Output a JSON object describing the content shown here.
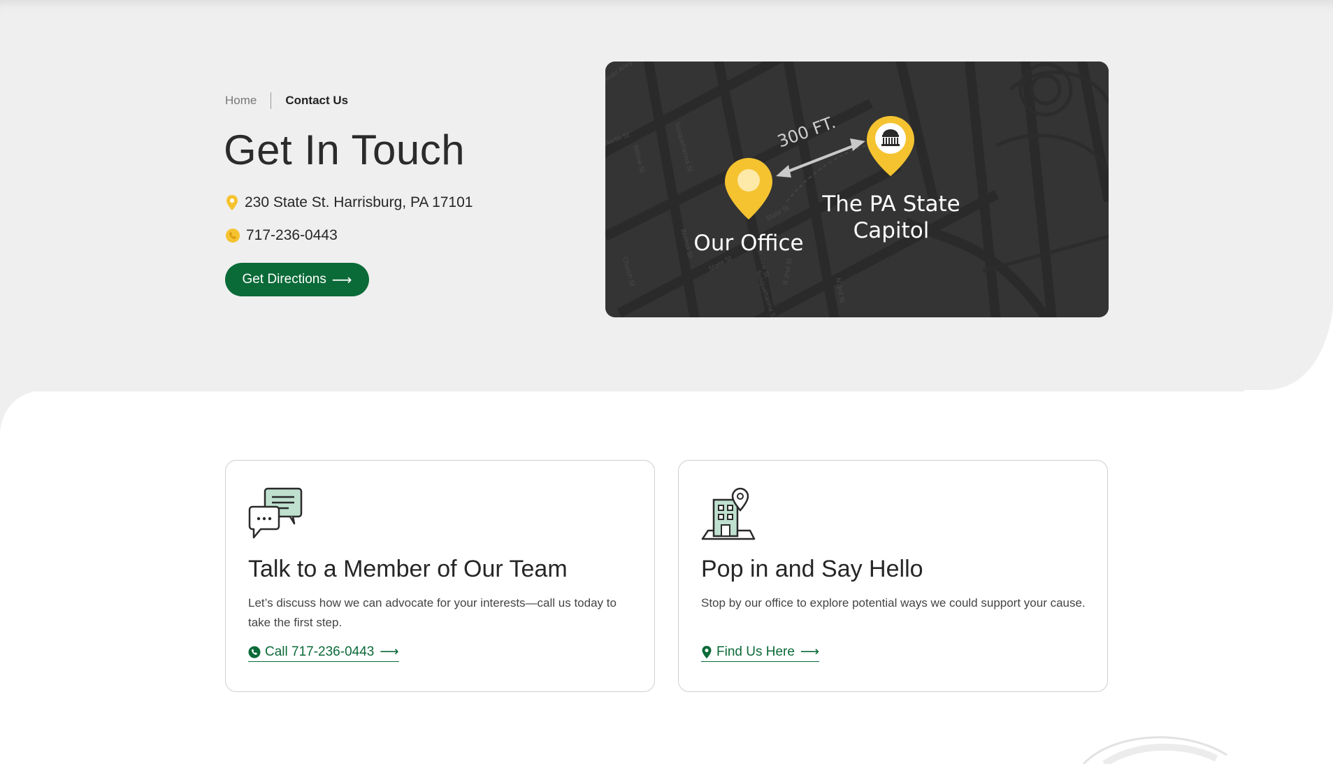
{
  "breadcrumb": {
    "home": "Home",
    "current": "Contact Us"
  },
  "hero": {
    "title": "Get In Touch",
    "address": "230 State St. Harrisburg, PA 17101",
    "phone": "717-236-0443",
    "directions_label": "Get Directions",
    "arrow": "⟶"
  },
  "map": {
    "distance_label": "300 FT.",
    "office_label": "Our Office",
    "capitol_label_line1": "The PA State",
    "capitol_label_line2": "Capitol",
    "streets": [
      "Walnut St",
      "Church St",
      "State St",
      "Susquehanna St",
      "N 2nd St",
      "N 3rd St",
      "Strawberry St",
      "River Alley",
      "Willow St",
      "North St"
    ]
  },
  "cards": [
    {
      "icon": "chat-bubbles-icon",
      "title": "Talk to a Member of Our Team",
      "text": "Let’s discuss how we can advocate for your interests—call us today to take the first step.",
      "link_label": "Call 717-236-0443",
      "link_icon": "phone-icon"
    },
    {
      "icon": "building-location-icon",
      "title": "Pop in and Say Hello",
      "text": "Stop by our office to explore potential ways we could support your cause.",
      "link_label": "Find Us Here",
      "link_icon": "map-pin-icon"
    }
  ],
  "colors": {
    "brand_green": "#0a6a38",
    "accent_yellow": "#f5c330",
    "hero_bg": "#efefef",
    "map_bg": "#343434"
  }
}
